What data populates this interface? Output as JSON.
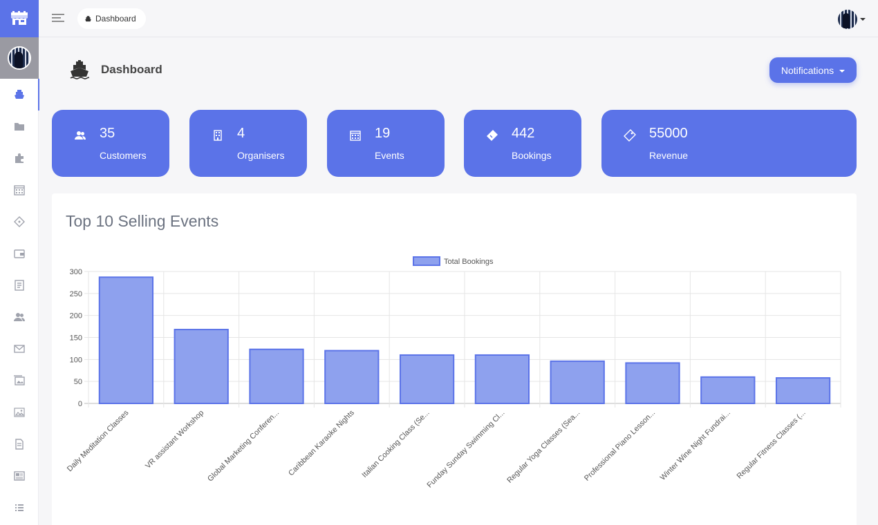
{
  "topbar": {
    "breadcrumb": "Dashboard"
  },
  "sidebar": {
    "items": [
      {
        "icon": "ship-icon",
        "active": true
      },
      {
        "icon": "folder-icon"
      },
      {
        "icon": "puzzle-icon"
      },
      {
        "icon": "calendar-icon"
      },
      {
        "icon": "ticket-icon"
      },
      {
        "icon": "wallet-icon"
      },
      {
        "icon": "book-icon"
      },
      {
        "icon": "users-icon"
      },
      {
        "icon": "mail-icon"
      },
      {
        "icon": "images-icon"
      },
      {
        "icon": "image-icon"
      },
      {
        "icon": "file-icon"
      },
      {
        "icon": "newspaper-icon"
      },
      {
        "icon": "list-icon"
      }
    ]
  },
  "page": {
    "title": "Dashboard",
    "notifications_label": "Notifications"
  },
  "stats": [
    {
      "value": "35",
      "label": "Customers",
      "icon": "users-icon"
    },
    {
      "value": "4",
      "label": "Organisers",
      "icon": "building-icon"
    },
    {
      "value": "19",
      "label": "Events",
      "icon": "calendar-icon"
    },
    {
      "value": "442",
      "label": "Bookings",
      "icon": "ticket-icon"
    },
    {
      "value": "55000",
      "label": "Revenue",
      "icon": "tag-icon"
    }
  ],
  "colors": {
    "accent": "#5b73e8",
    "bar_fill": "#8ea1ee",
    "bar_stroke": "#5b73e8"
  },
  "panel": {
    "title": "Top 10 Selling Events"
  },
  "chart_data": {
    "type": "bar",
    "categories": [
      "Daily Meditation Classes",
      "VR assistant Workshop",
      "Global Marketing Conferen...",
      "Caribbean Karaoke Nights",
      "Italian Cooking Class (Se...",
      "Funday Sunday Swimming Cl...",
      "Regular Yoga Classes (Sea...",
      "Professional Piano Lesson...",
      "Winter Wine Night Fundrai...",
      "Regular Fitness Classes (..."
    ],
    "series": [
      {
        "name": "Total Bookings",
        "values": [
          287,
          168,
          123,
          120,
          110,
          110,
          96,
          92,
          60,
          58
        ]
      }
    ],
    "yticks": [
      0,
      50,
      100,
      150,
      200,
      250,
      300
    ],
    "ylim": [
      0,
      300
    ],
    "legend": "top-center",
    "grid": true
  }
}
